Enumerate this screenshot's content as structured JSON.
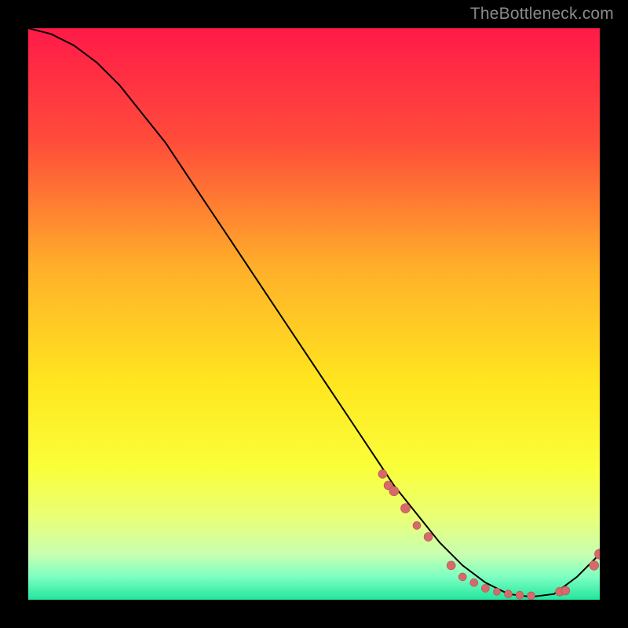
{
  "watermark": "TheBottleneck.com",
  "colors": {
    "bg": "#000000",
    "watermark": "#8a8a8a",
    "curve": "#000000",
    "marker_fill": "#d66a6a",
    "marker_stroke": "#b84f4f"
  },
  "chart_data": {
    "type": "line",
    "title": "",
    "xlabel": "",
    "ylabel": "",
    "xlim": [
      0,
      100
    ],
    "ylim": [
      0,
      100
    ],
    "gradient_stops": [
      {
        "offset": 0,
        "color": "#ff1a49"
      },
      {
        "offset": 20,
        "color": "#ff4d3a"
      },
      {
        "offset": 42,
        "color": "#ffb029"
      },
      {
        "offset": 62,
        "color": "#ffe61f"
      },
      {
        "offset": 77,
        "color": "#faff3a"
      },
      {
        "offset": 86,
        "color": "#e8ff7a"
      },
      {
        "offset": 92,
        "color": "#c8ffb0"
      },
      {
        "offset": 96,
        "color": "#7dffc2"
      },
      {
        "offset": 100,
        "color": "#22e59f"
      }
    ],
    "series": [
      {
        "name": "bottleneck-curve",
        "x": [
          0,
          4,
          8,
          12,
          16,
          20,
          24,
          28,
          32,
          36,
          40,
          44,
          48,
          52,
          56,
          60,
          64,
          68,
          72,
          76,
          80,
          84,
          88,
          92,
          96,
          100
        ],
        "y": [
          100,
          99,
          97,
          94,
          90,
          85,
          80,
          74,
          68,
          62,
          56,
          50,
          44,
          38,
          32,
          26,
          20,
          15,
          10,
          6,
          3,
          1,
          0.5,
          1,
          4,
          8
        ]
      }
    ],
    "markers": {
      "name": "points",
      "x": [
        62,
        63,
        64,
        66,
        68,
        70,
        74,
        76,
        78,
        80,
        82,
        84,
        86,
        88,
        93,
        94,
        99,
        100
      ],
      "y": [
        22,
        20,
        19,
        16,
        13,
        11,
        6,
        4,
        3,
        2,
        1.4,
        1,
        0.8,
        0.7,
        1.4,
        1.6,
        6,
        8
      ],
      "r": [
        5.5,
        5.5,
        6,
        6,
        5,
        5.5,
        5.5,
        5,
        5,
        5,
        4.5,
        5,
        5,
        5,
        5.5,
        5.5,
        6,
        6.5
      ]
    }
  }
}
